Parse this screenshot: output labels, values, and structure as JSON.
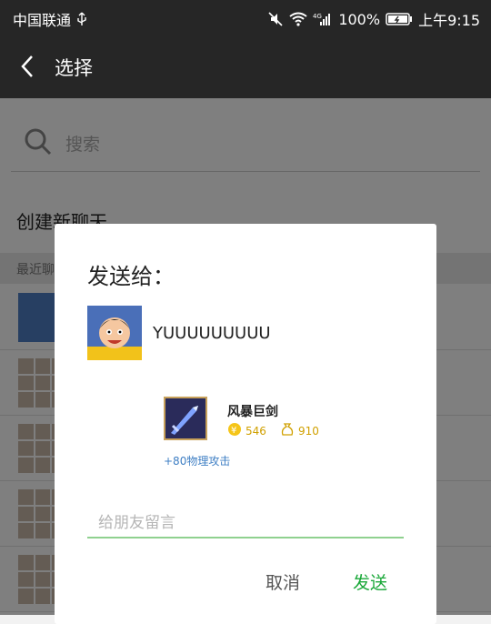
{
  "status_bar": {
    "carrier": "中国联通",
    "battery": "100%",
    "time": "上午9:15",
    "network": "4G"
  },
  "header": {
    "title": "选择"
  },
  "search": {
    "placeholder": "搜索"
  },
  "list": {
    "create_new_chat": "创建新聊天",
    "section_label": "最近聊天"
  },
  "dialog": {
    "title": "发送给：",
    "recipient_name": "YUUUUUUUUU",
    "item": {
      "name": "风暴巨剑",
      "gold_cost": "546",
      "gold_total": "910",
      "stat": "+80物理攻击"
    },
    "message_placeholder": "给朋友留言",
    "cancel_label": "取消",
    "send_label": "发送"
  },
  "colors": {
    "accent_send": "#1aa839",
    "input_underline": "#8fd18f",
    "header_bg": "#262626"
  }
}
